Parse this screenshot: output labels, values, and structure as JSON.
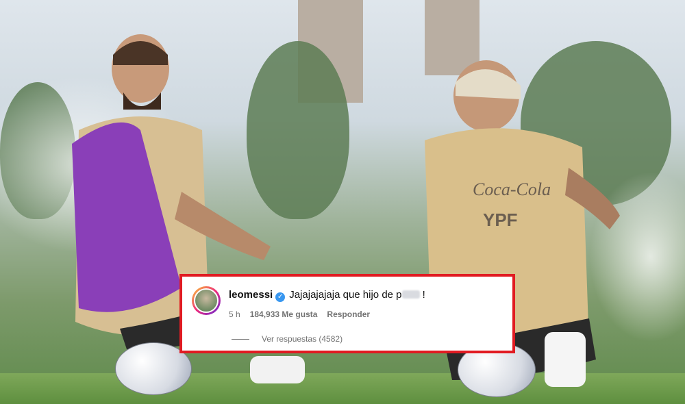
{
  "comment": {
    "username": "leomessi",
    "verified_icon": "verified-badge-icon",
    "text_before": "Jajajajajaja que hijo de p",
    "text_after": " !",
    "time": "5 h",
    "likes": "184,933 Me gusta",
    "reply": "Responder",
    "view_replies": "Ver respuestas (4582)"
  },
  "colors": {
    "highlight_border": "#e11b22",
    "verified": "#3897f0",
    "secondary_text": "#737373"
  },
  "sponsor_text": {
    "brand1": "Coca-Cola",
    "brand2": "YPF"
  }
}
